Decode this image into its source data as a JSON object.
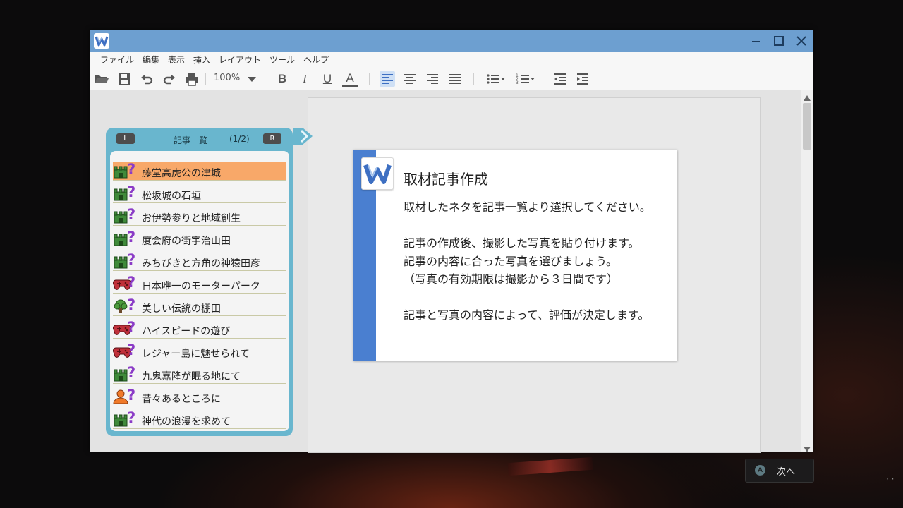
{
  "window": {
    "menu": [
      "ファイル",
      "編集",
      "表示",
      "挿入",
      "レイアウト",
      "ツール",
      "ヘルプ"
    ],
    "zoom": "100%"
  },
  "toolbar": {
    "bold": "B",
    "italic": "I",
    "underline": "U",
    "font_color": "A"
  },
  "dialog": {
    "title": "取材記事作成",
    "lines": [
      "取材したネタを記事一覧より選択してください。",
      "記事の作成後、撮影した写真を貼り付けます。",
      "記事の内容に合った写真を選びましょう。",
      "（写真の有効期限は撮影から３日間です）",
      "記事と写真の内容によって、評価が決定します。"
    ]
  },
  "article_list": {
    "title": "記事一覧",
    "page": "(1/2)",
    "prev_button": "L",
    "next_button": "R",
    "unknown_mark": "?",
    "items": [
      {
        "label": "藤堂高虎公の津城",
        "icon": "castle-icon",
        "selected": true
      },
      {
        "label": "松坂城の石垣",
        "icon": "castle-icon",
        "selected": false
      },
      {
        "label": "お伊勢参りと地域創生",
        "icon": "castle-icon",
        "selected": false
      },
      {
        "label": "度会府の街宇治山田",
        "icon": "castle-icon",
        "selected": false
      },
      {
        "label": "みちびきと方角の神猿田彦",
        "icon": "castle-icon",
        "selected": false
      },
      {
        "label": "日本唯一のモーターパーク",
        "icon": "gamepad-icon",
        "selected": false
      },
      {
        "label": "美しい伝統の棚田",
        "icon": "tree-icon",
        "selected": false
      },
      {
        "label": "ハイスピードの遊び",
        "icon": "gamepad-icon",
        "selected": false
      },
      {
        "label": "レジャー島に魅せられて",
        "icon": "gamepad-icon",
        "selected": false
      },
      {
        "label": "九鬼嘉隆が眠る地にて",
        "icon": "castle-icon",
        "selected": false
      },
      {
        "label": "昔々あるところに",
        "icon": "person-icon",
        "selected": false
      },
      {
        "label": "神代の浪漫を求めて",
        "icon": "castle-icon",
        "selected": false
      }
    ]
  },
  "prompt": {
    "button": "A",
    "label": "次へ"
  },
  "colors": {
    "titlebar": "#6d9fd0",
    "dialog_accent": "#4a7fd0",
    "panel": "#69b6ce",
    "selected_item": "#f8a869",
    "castle_icon": "#3f8a3a",
    "gamepad_icon": "#c0303a",
    "tree_icon": "#4b9a3c",
    "person_icon": "#f07a2a",
    "question_mark": "#8b3cc7"
  }
}
